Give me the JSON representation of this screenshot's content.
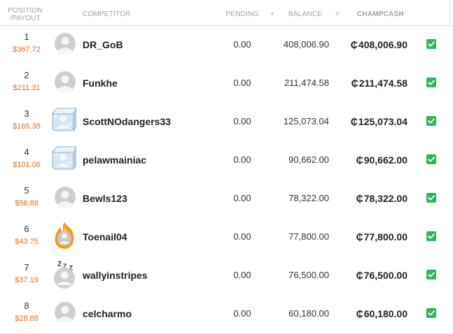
{
  "header": {
    "position_label": "POSITION",
    "payout_label": "/PAYOUT",
    "competitor_label": "COMPETITOR",
    "pending_label": "PENDING",
    "plus_sign": "+",
    "balance_label": "BALANCE",
    "equals_sign": "=",
    "champcash_label": "CHAMPCASH"
  },
  "currency_symbol": "₵",
  "colors": {
    "payout": "#e2711d",
    "check_green": "#2fb55b",
    "header_text": "#9aa0a6"
  },
  "rows": [
    {
      "position": "1",
      "payout": "$367.72",
      "avatar": "default-avatar-icon",
      "name": "DR_GoB",
      "pending": "0.00",
      "balance": "408,006.90",
      "champcash": "408,006.90",
      "checked": true
    },
    {
      "position": "2",
      "payout": "$211.31",
      "avatar": "default-avatar-icon",
      "name": "Funkhe",
      "pending": "0.00",
      "balance": "211,474.58",
      "champcash": "211,474.58",
      "checked": true
    },
    {
      "position": "3",
      "payout": "$165.38",
      "avatar": "ice-cube-avatar-icon",
      "name": "ScottNOdangers33",
      "pending": "0.00",
      "balance": "125,073.04",
      "champcash": "125,073.04",
      "checked": true
    },
    {
      "position": "4",
      "payout": "$101.06",
      "avatar": "ice-cube-avatar-icon",
      "name": "pelawmainiac",
      "pending": "0.00",
      "balance": "90,662.00",
      "champcash": "90,662.00",
      "checked": true
    },
    {
      "position": "5",
      "payout": "$56.88",
      "avatar": "default-avatar-icon",
      "name": "Bewls123",
      "pending": "0.00",
      "balance": "78,322.00",
      "champcash": "78,322.00",
      "checked": true
    },
    {
      "position": "6",
      "payout": "$43.75",
      "avatar": "fire-avatar-icon",
      "name": "Toenail04",
      "pending": "0.00",
      "balance": "77,800.00",
      "champcash": "77,800.00",
      "checked": true
    },
    {
      "position": "7",
      "payout": "$37.19",
      "avatar": "sleeping-avatar-icon",
      "name": "wallyinstripes",
      "pending": "0.00",
      "balance": "76,500.00",
      "champcash": "76,500.00",
      "checked": true
    },
    {
      "position": "8",
      "payout": "$28.88",
      "avatar": "default-avatar-icon",
      "name": "celcharmo",
      "pending": "0.00",
      "balance": "60,180.00",
      "champcash": "60,180.00",
      "checked": true
    }
  ]
}
